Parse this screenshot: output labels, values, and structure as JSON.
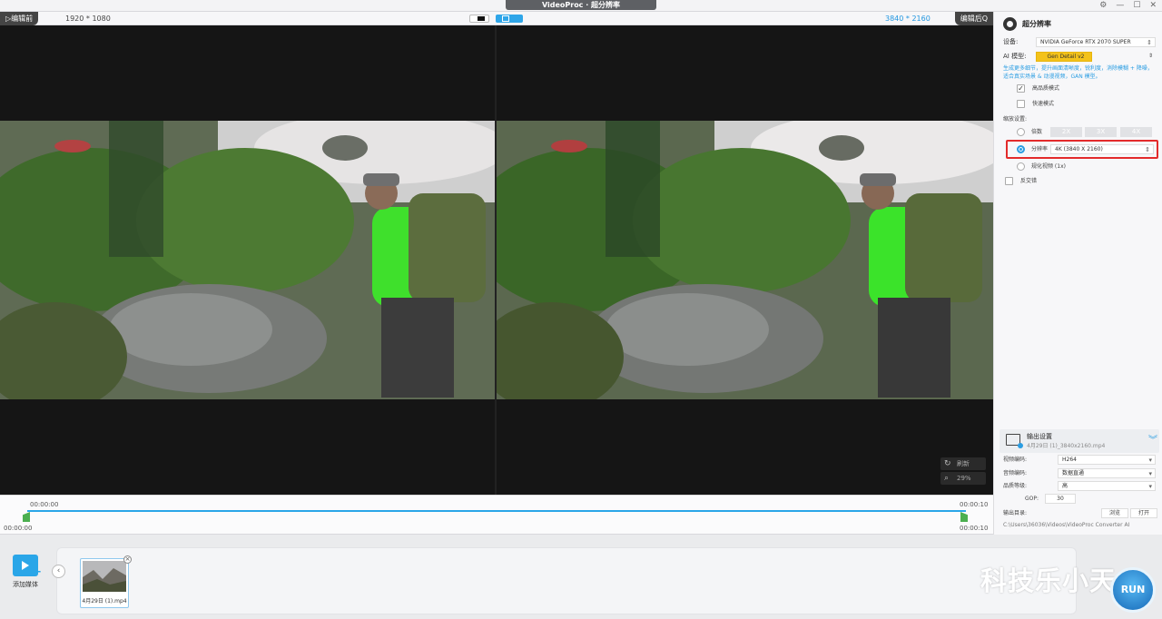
{
  "window": {
    "title": "VideoProc · 超分辨率",
    "controls": [
      "⚙",
      "—",
      "☐",
      "✕"
    ]
  },
  "preview": {
    "before_label": "▷编辑前",
    "after_label": "编辑后Q",
    "resolution_left": "1920 * 1080",
    "resolution_right": "3840 * 2160",
    "refresh_label": "刷新",
    "zoom_label": "29%"
  },
  "timeline": {
    "time_top_left": "00:00:00",
    "time_bottom_left": "00:00:00",
    "time_top_right": "00:00:10",
    "time_bottom_right": "00:00:10"
  },
  "panel": {
    "title": "超分辨率",
    "device_label": "设备:",
    "device_value": "NVIDIA GeForce RTX 2070 SUPER",
    "ai_model_label": "AI 模型:",
    "ai_model_value": "Gen Detail v2",
    "hint": "生成更多细节，提升画面清晰度，锐利度，消除模糊 + 降噪，适合真实场景 & 动漫视频，GAN 模型。",
    "high_quality_label": "高品质模式",
    "high_quality_checked": true,
    "fast_mode_label": "快速模式",
    "scale_settings_label": "缩放设置:",
    "multiplier_label": "倍数",
    "multipliers": [
      "2X",
      "3X",
      "4X"
    ],
    "resolution_label": "分辨率",
    "resolution_value": "4K (3840 X 2160)",
    "normalize_label": "规化视频 (1x)",
    "interlace_label": "反交错",
    "output": {
      "title": "输出设置",
      "filename": "4月29日 (1)_3840x2160.mp4",
      "video_codec_label": "视频编码:",
      "video_codec_value": "H264",
      "audio_codec_label": "音频编码:",
      "audio_codec_value": "数据直通",
      "quality_label": "品质等级:",
      "quality_value": "高",
      "gop_label": "GOP:",
      "gop_value": "30",
      "dir_label": "输出目录:",
      "browse_label": "浏览",
      "open_label": "打开",
      "path": "C:\\Users\\36036\\Videos\\VideoProc Converter AI"
    }
  },
  "media": {
    "add_label": "添加媒体",
    "collapse_icon": "‹",
    "file_name": "4月29日 (1).mp4",
    "run_label": "RUN"
  },
  "watermark": "科技乐小天",
  "colors": {
    "accent": "#2a9de2",
    "gold": "#f3c21a",
    "highlight": "#e32b2b"
  }
}
